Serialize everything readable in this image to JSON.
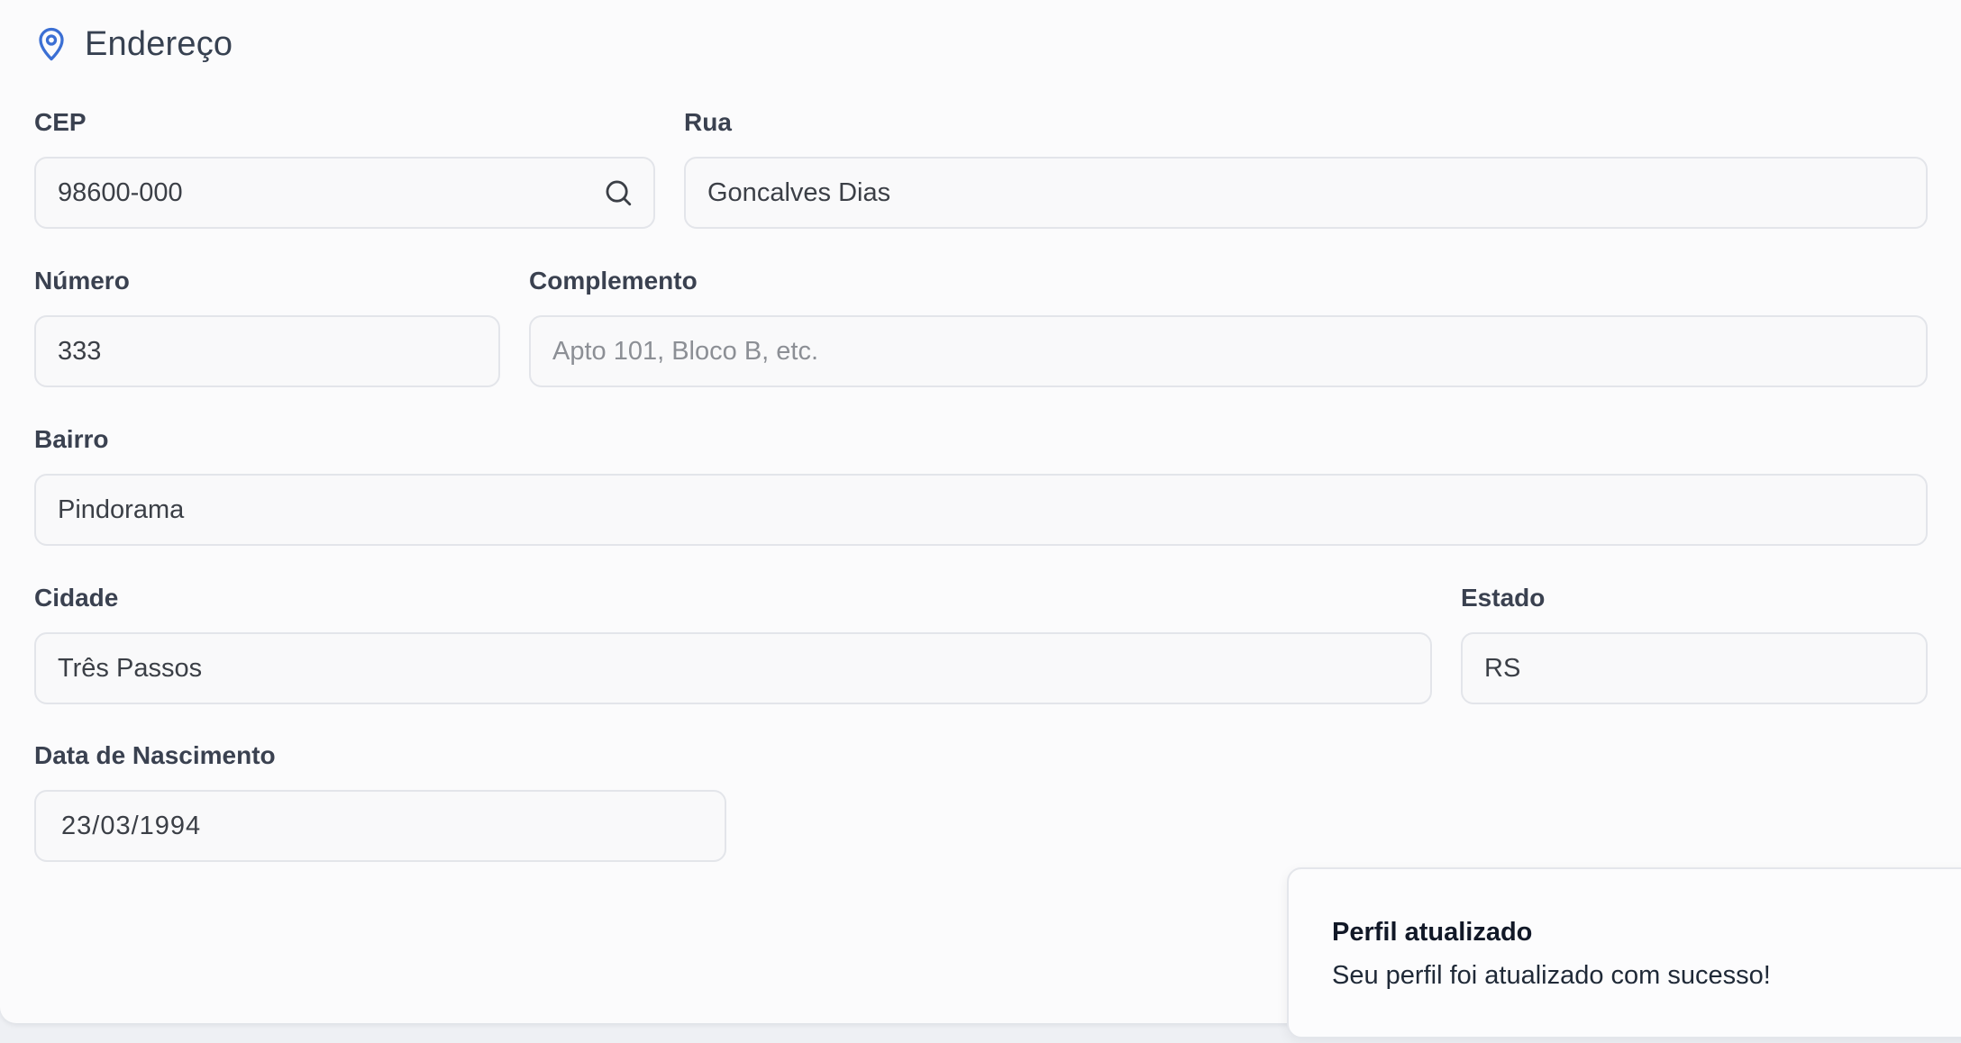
{
  "section": {
    "title": "Endereço",
    "icon": "map-pin-icon",
    "accent_color": "#3b6fd4"
  },
  "fields": {
    "cep": {
      "label": "CEP",
      "value": "98600-000",
      "icon": "search-icon"
    },
    "rua": {
      "label": "Rua",
      "value": "Goncalves Dias"
    },
    "numero": {
      "label": "Número",
      "value": "333"
    },
    "complemento": {
      "label": "Complemento",
      "value": "",
      "placeholder": "Apto 101, Bloco B, etc."
    },
    "bairro": {
      "label": "Bairro",
      "value": "Pindorama"
    },
    "cidade": {
      "label": "Cidade",
      "value": "Três Passos"
    },
    "estado": {
      "label": "Estado",
      "value": "RS"
    },
    "data_nascimento": {
      "label": "Data de Nascimento",
      "value": "23/03/1994"
    }
  },
  "toast": {
    "title": "Perfil atualizado",
    "message": "Seu perfil foi atualizado com sucesso!"
  }
}
